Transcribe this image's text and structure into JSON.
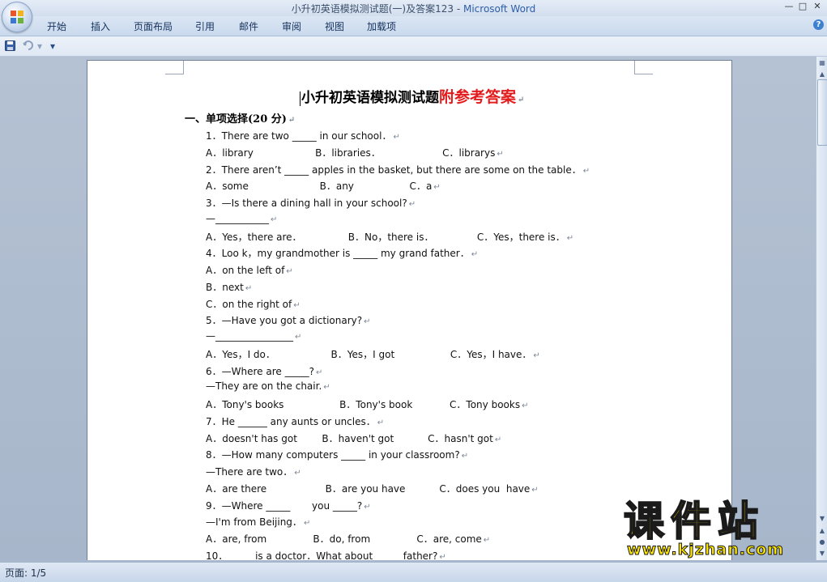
{
  "window": {
    "title": "小升初英语模拟测试题(一)及答案123",
    "app_name": "Microsoft Word",
    "minimize": "—",
    "maximize": "□",
    "close": "✕"
  },
  "ribbon": {
    "tabs": [
      "开始",
      "插入",
      "页面布局",
      "引用",
      "邮件",
      "审阅",
      "视图",
      "加载项"
    ],
    "help": "?"
  },
  "quick_access": {
    "save_icon": "save-icon",
    "undo_icon": "undo-icon",
    "more": "▾"
  },
  "document": {
    "title_black": "小升初英语模拟测试题",
    "title_red": "附参考答案",
    "section": "一、单项选择(20 分)",
    "paragraph_mark": "↵",
    "lines": [
      "1．There are two _____ in our school．",
      "A．library                    B．libraries．                    C．librarys",
      "2．There aren’t _____ apples in the basket, but there are some on the table．",
      "A．some                       B．any                  C．a",
      "3．—Is there a dining hall in your school?",
      "—___________",
      "A．Yes，there are．               B．No，there is．              C．Yes，there is．",
      "4．Loo k，my grandmother is _____ my grand father．",
      "A．on the left of",
      "B．next",
      "C．on the right of",
      "5．—Have you got a dictionary?",
      "—________________",
      "A．Yes，I do．                  B．Yes，I got                  C．Yes，I have．",
      "6．—Where are _____?",
      "—They are on the chair.",
      "A．Tony's books                  B．Tony's book            C．Tony books",
      "7．He ______ any aunts or uncles．",
      "A．doesn't has got        B．haven't got           C．hasn't got",
      "8．—How many computers _____ in your classroom?",
      "—There are two．",
      "A．are there                   B．are you have           C．does you  have",
      "9．—Where _____       you _____?",
      "—I'm from Beijing．",
      "A．are, from               B．do, from               C．are, come",
      "10．_____ is a doctor．What about _____ father?"
    ]
  },
  "status": {
    "page_info": "页面: 1/5"
  },
  "watermark": {
    "chinese": "课件站",
    "url": "www.kjzhan.com"
  },
  "colors": {
    "accent_red": "#e21c1c",
    "watermark_yellow": "#ffe700",
    "app_blue": "#2d5ea8"
  }
}
